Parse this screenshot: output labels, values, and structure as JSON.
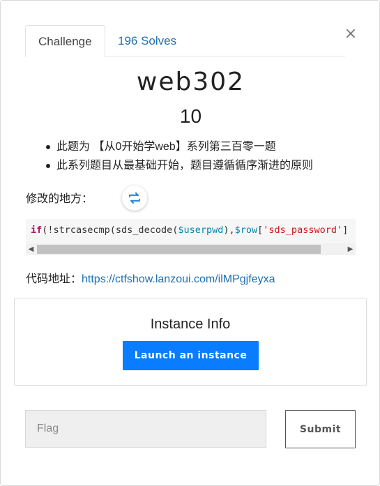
{
  "tabs": {
    "challenge_label": "Challenge",
    "solves_label": "196 Solves"
  },
  "close_symbol": "×",
  "challenge": {
    "name": "web302",
    "value": "10",
    "description": [
      "此题为 【从0开始学web】系列第三百零一题",
      "此系列题目从最基础开始，题目遵循循序渐进的原则"
    ],
    "modified_label": "修改的地方：",
    "code": {
      "kw_if": "if",
      "part1": "(!strcasecmp(sds_decode(",
      "var1": "$userpwd",
      "part2": "),",
      "var2": "$row",
      "part3": "[",
      "str1": "'sds_password'",
      "part4": "]"
    },
    "url_label": "代码地址：",
    "url": "https://ctfshow.lanzoui.com/ilMPgjfeyxa"
  },
  "instance": {
    "title": "Instance Info",
    "launch_label": "Launch an instance"
  },
  "flag": {
    "placeholder": "Flag",
    "submit_label": "Submit"
  },
  "colors": {
    "accent": "#0a7cff",
    "link": "#1f6fb2"
  },
  "icons": {
    "refresh": "refresh-icon",
    "close": "close-icon"
  }
}
